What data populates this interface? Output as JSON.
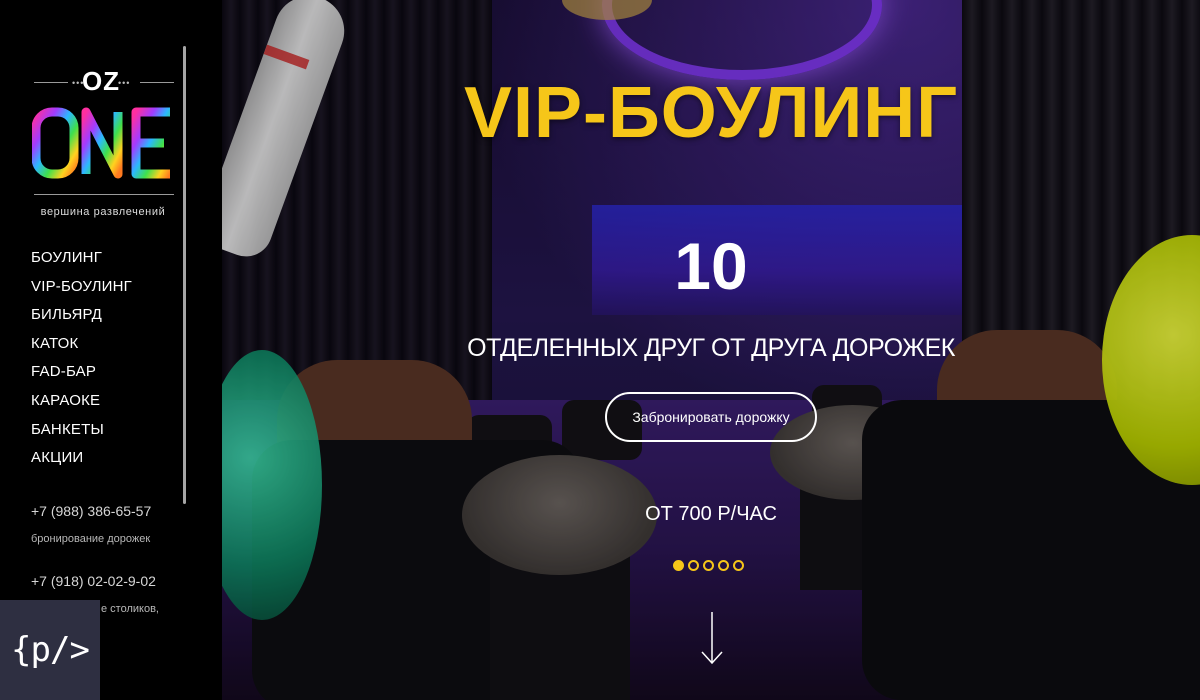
{
  "brand": {
    "top": "OZ",
    "name": "ONE",
    "tagline": "вершина развлечений"
  },
  "menu": [
    {
      "label": "БОУЛИНГ"
    },
    {
      "label": "VIP-БОУЛИНГ"
    },
    {
      "label": "БИЛЬЯРД"
    },
    {
      "label": "КАТОК"
    },
    {
      "label": "FAD-БАР"
    },
    {
      "label": "КАРАОКЕ"
    },
    {
      "label": "БАНКЕТЫ"
    },
    {
      "label": "АКЦИИ"
    }
  ],
  "contacts": [
    {
      "phone": "+7 (988) 386-65-57",
      "note": "бронирование дорожек"
    },
    {
      "phone": "+7 (918) 02-02-9-02",
      "note": "е столиков,"
    }
  ],
  "badge": {
    "text": "{p/>"
  },
  "hero": {
    "title": "VIP-БОУЛИНГ",
    "number": "10",
    "subtitle": "ОТДЕЛЕННЫХ ДРУГ ОТ ДРУГА ДОРОЖЕК",
    "button_label": "Забронировать дорожку",
    "price": "ОТ 700 Р/ЧАС"
  },
  "slider": {
    "count": 5,
    "active": 1
  },
  "colors": {
    "accent": "#f6c619",
    "sidebar": "#000000",
    "badge": "#2e2f41"
  },
  "icons": {
    "scroll_down": "arrow-down-icon",
    "logo": "oz-one-logo"
  }
}
